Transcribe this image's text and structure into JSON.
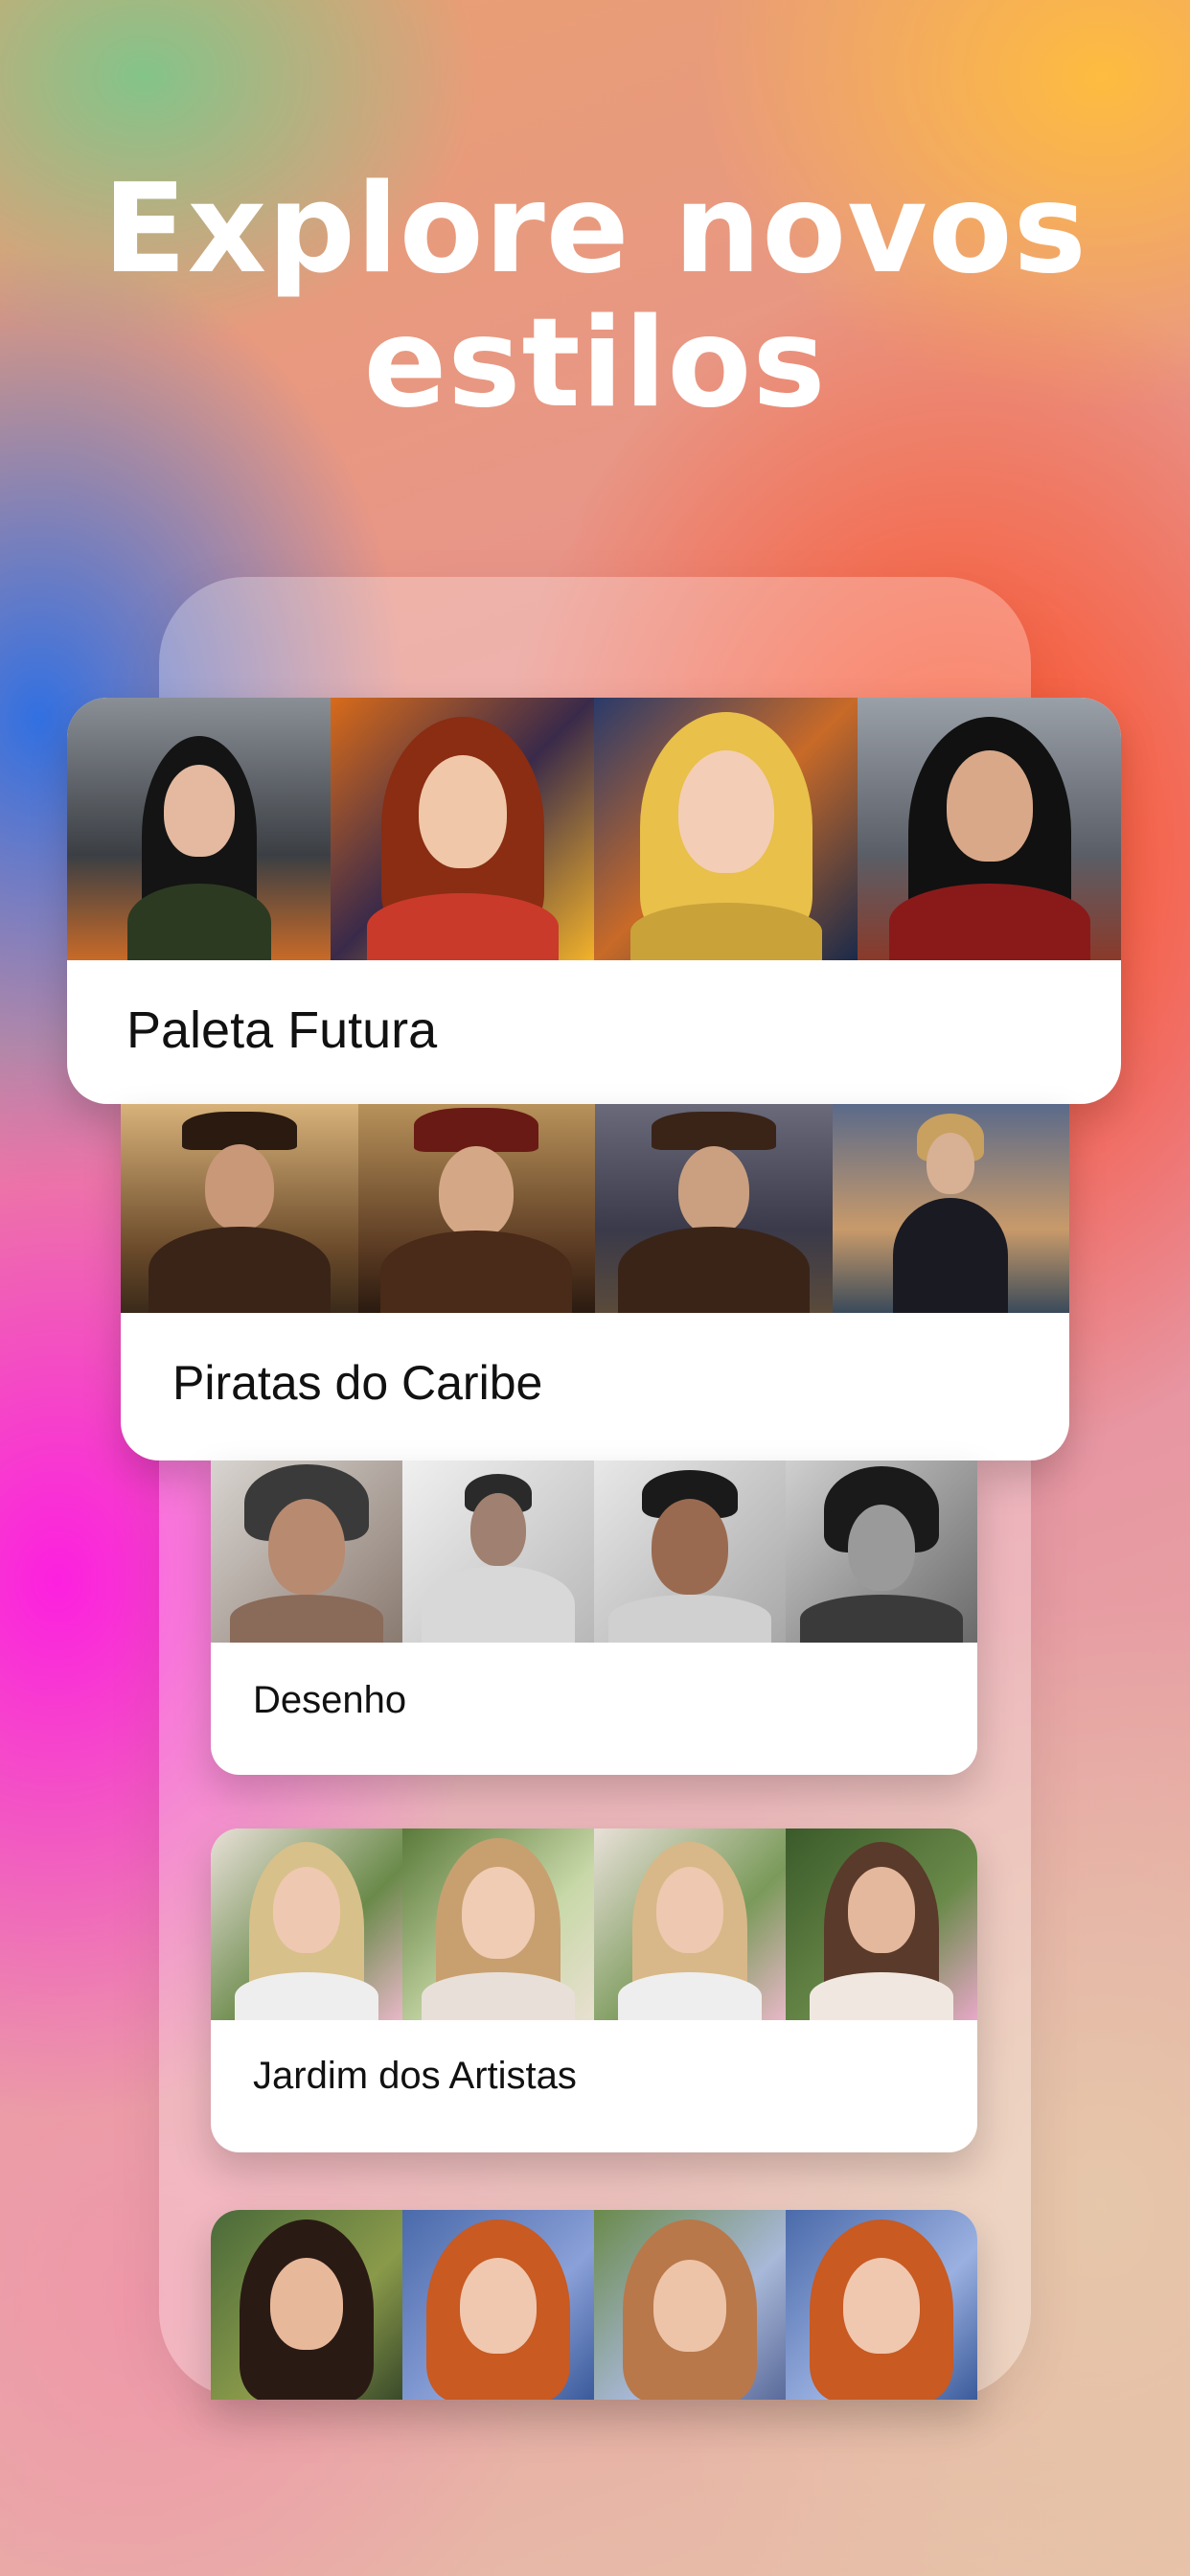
{
  "headline": {
    "line1": "Explore novos",
    "line2": "estilos"
  },
  "styles": [
    {
      "title": "Paleta Futura",
      "thumbs": [
        "portrait-1",
        "portrait-2",
        "portrait-3",
        "portrait-4"
      ]
    },
    {
      "title": "Piratas do Caribe",
      "thumbs": [
        "portrait-1",
        "portrait-2",
        "portrait-3",
        "portrait-4"
      ]
    },
    {
      "title": "Desenho",
      "thumbs": [
        "portrait-1",
        "portrait-2",
        "portrait-3",
        "portrait-4"
      ]
    },
    {
      "title": "Jardim dos Artistas",
      "thumbs": [
        "portrait-1",
        "portrait-2",
        "portrait-3",
        "portrait-4"
      ]
    },
    {
      "title": "",
      "thumbs": [
        "portrait-1",
        "portrait-2",
        "portrait-3",
        "portrait-4"
      ]
    }
  ]
}
